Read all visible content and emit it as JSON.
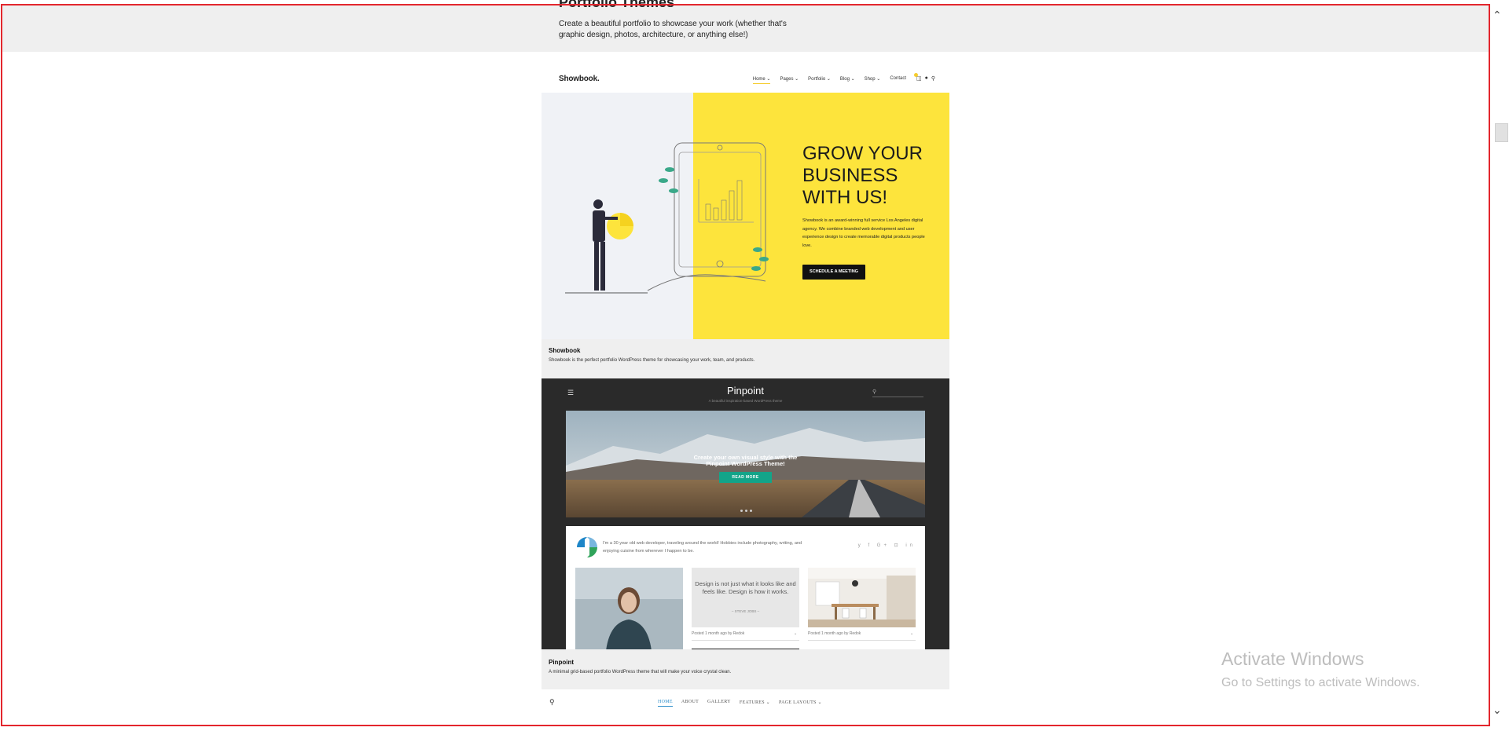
{
  "section": {
    "title": "Portfolio Themes",
    "description": "Create a beautiful portfolio to showcase your work (whether that's graphic design, photos, architecture, or anything else!)"
  },
  "showbook": {
    "logo": "Showbook.",
    "menu": [
      "Home ⌄",
      "Pages ⌄",
      "Portfolio ⌄",
      "Blog ⌄",
      "Shop ⌄",
      "Contact"
    ],
    "headline": "GROW YOUR BUSINESS WITH US!",
    "body": "Showbook is an award-winning full service Los Angeles digital agency. We combine branded web development and user experience design to create memorable digital products people love.",
    "button": "SCHEDULE A MEETING",
    "caption_title": "Showbook",
    "caption_desc": "Showbook is the perfect portfolio WordPress theme for showcasing your work, team, and products."
  },
  "pinpoint": {
    "title": "Pinpoint",
    "tagline": "A beautiful inspiration-based WordPress theme",
    "banner_line1": "Create your own visual style with the",
    "banner_line2": "Pinpoint WordPress Theme!",
    "read_more": "READ MORE",
    "bio": "I'm a 30 year old web developer, traveling around the world! Hobbies include photography, writing, and enjoying cuisine from wherever I happen to be.",
    "social": "y f G+ ⊡ in",
    "quote": "Design is not just what it looks like and feels like. Design is how it works.",
    "quote_author": "– STEVE JOBS –",
    "meta1": "Posted 1 month ago by Redok",
    "meta2": "Posted 1 month ago by Redok",
    "caption_title": "Pinpoint",
    "caption_desc": "A minimal grid-based portfolio WordPress theme that will make your voice crystal clean."
  },
  "third_theme": {
    "menu": [
      "HOME",
      "ABOUT",
      "GALLERY",
      "FEATURES ⌄",
      "PAGE LAYOUTS ⌄"
    ]
  },
  "watermark": {
    "title": "Activate Windows",
    "subtitle": "Go to Settings to activate Windows."
  },
  "colors": {
    "frame": "#e3262d",
    "showbook_yellow": "#fde43c",
    "pinpoint_accent": "#13a489",
    "third_theme_active": "#2f8fcb"
  }
}
